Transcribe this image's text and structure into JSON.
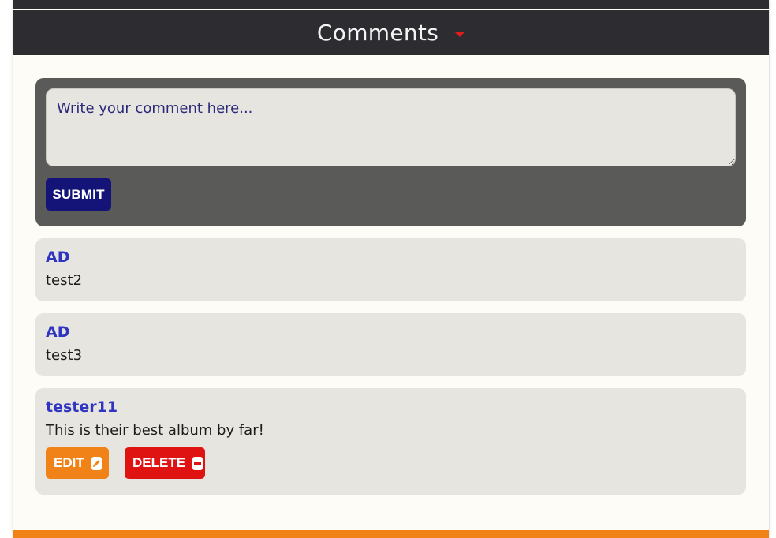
{
  "header": {
    "title": "Comments",
    "toggle_icon": "caret-down-icon",
    "accent_color": "#e21b1b"
  },
  "comment_form": {
    "placeholder": "Write your comment here...",
    "value": "",
    "submit_label": "SUBMIT"
  },
  "comments": [
    {
      "author": "AD",
      "text": "test2"
    },
    {
      "author": "AD",
      "text": "test3"
    },
    {
      "author": "tester11",
      "text": "This is their best album by far!",
      "edit_label": "EDIT",
      "edit_icon": "pencil-icon",
      "delete_label": "DELETE",
      "delete_icon": "minus-square-icon"
    }
  ],
  "colors": {
    "header_bg": "#2d2c31",
    "form_bg": "#5a5a58",
    "submit_bg": "#141478",
    "card_bg": "#e6e5df",
    "author_color": "#2f35c0",
    "edit_bg": "#f08217",
    "delete_bg": "#e01313"
  }
}
